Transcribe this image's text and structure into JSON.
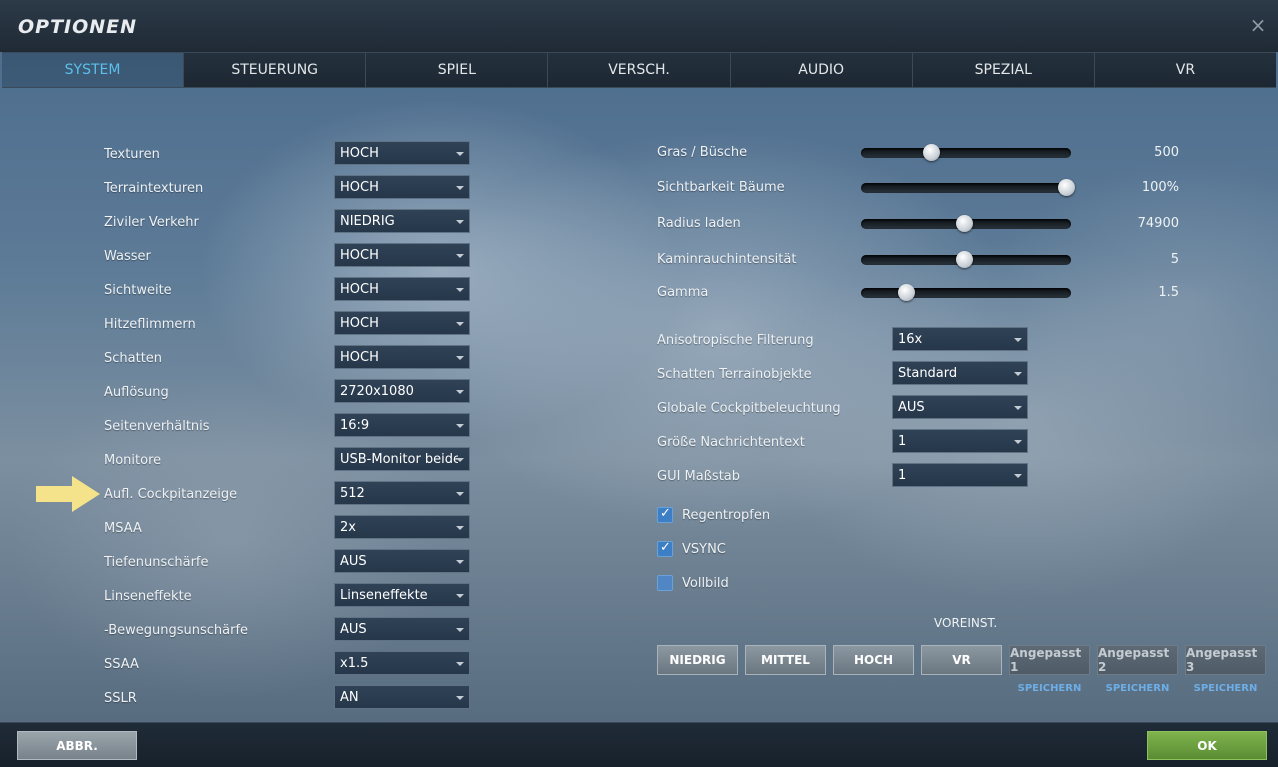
{
  "window": {
    "title": "OPTIONEN",
    "close_icon": "×"
  },
  "tabs": [
    "SYSTEM",
    "STEUERUNG",
    "SPIEL",
    "VERSCH.",
    "AUDIO",
    "SPEZIAL",
    "VR"
  ],
  "active_tab": "SYSTEM",
  "left_settings": [
    {
      "label": "Texturen",
      "value": "HOCH"
    },
    {
      "label": "Terraintexturen",
      "value": "HOCH"
    },
    {
      "label": "Ziviler Verkehr",
      "value": "NIEDRIG"
    },
    {
      "label": "Wasser",
      "value": "HOCH"
    },
    {
      "label": "Sichtweite",
      "value": "HOCH"
    },
    {
      "label": "Hitzeflimmern",
      "value": "HOCH"
    },
    {
      "label": "Schatten",
      "value": "HOCH"
    },
    {
      "label": "Auflösung",
      "value": "2720x1080"
    },
    {
      "label": "Seitenverhältnis",
      "value": "16:9"
    },
    {
      "label": "Monitore",
      "value": "USB-Monitor beide M"
    },
    {
      "label": "Aufl. Cockpitanzeige",
      "value": "512"
    },
    {
      "label": "MSAA",
      "value": "2x"
    },
    {
      "label": "Tiefenunschärfe",
      "value": "AUS"
    },
    {
      "label": "Linseneffekte",
      "value": "Linseneffekte"
    },
    {
      "label": "-Bewegungsunschärfe",
      "value": "AUS"
    },
    {
      "label": "SSAA",
      "value": "x1.5"
    },
    {
      "label": "SSLR",
      "value": "AN"
    }
  ],
  "annotation": {
    "icon": "arrow-right-icon",
    "color": "#f4e38a",
    "points_to": "Aufl. Cockpitanzeige"
  },
  "sliders": [
    {
      "label": "Gras / Büsche",
      "value": "500",
      "fraction": 0.34
    },
    {
      "label": "Sichtbarkeit Bäume",
      "value": "100%",
      "fraction": 1.0
    },
    {
      "label": "Radius laden",
      "value": "74900",
      "fraction": 0.5
    },
    {
      "label": "Kaminrauchintensität",
      "value": "5",
      "fraction": 0.5
    },
    {
      "label": "Gamma",
      "value": "1.5",
      "fraction": 0.22
    }
  ],
  "right_dropdowns": [
    {
      "label": "Anisotropische Filterung",
      "value": "16x"
    },
    {
      "label": "Schatten Terrainobjekte",
      "value": "Standard"
    },
    {
      "label": "Globale Cockpitbeleuchtung",
      "value": "AUS"
    },
    {
      "label": "Größe Nachrichtentext",
      "value": "1"
    },
    {
      "label": "GUI Maßstab",
      "value": "1"
    }
  ],
  "checkboxes": [
    {
      "label": "Regentropfen",
      "checked": true
    },
    {
      "label": "VSYNC",
      "checked": true
    },
    {
      "label": "Vollbild",
      "checked": false
    }
  ],
  "presets": {
    "title": "VOREINST.",
    "standard": [
      "NIEDRIG",
      "MITTEL",
      "HOCH",
      "VR"
    ],
    "custom": [
      "Angepasst 1",
      "Angepasst 2",
      "Angepasst 3"
    ],
    "save_label": "SPEICHERN"
  },
  "footer": {
    "cancel_label": "ABBR.",
    "ok_label": "OK"
  },
  "colors": {
    "accent_tab": "#5cc0ea",
    "ok_green": "#6fa341",
    "checkbox_blue": "#3d7fc6"
  }
}
